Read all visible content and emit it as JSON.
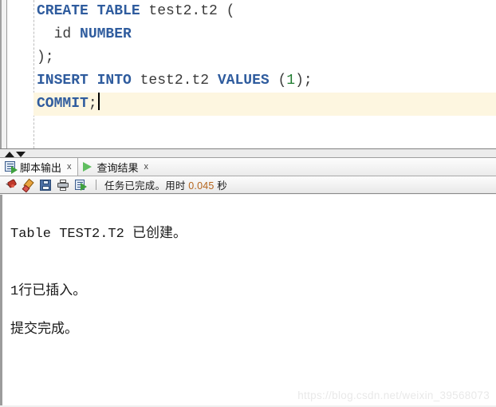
{
  "editor": {
    "lines": [
      {
        "highlighted": false,
        "tokens": [
          {
            "t": "CREATE TABLE",
            "k": "kw"
          },
          {
            "t": " test2.t2 (",
            "k": "id"
          }
        ]
      },
      {
        "highlighted": false,
        "tokens": [
          {
            "t": "  id ",
            "k": "id"
          },
          {
            "t": "NUMBER",
            "k": "kw"
          }
        ]
      },
      {
        "highlighted": false,
        "tokens": [
          {
            "t": ");",
            "k": "id"
          }
        ]
      },
      {
        "highlighted": false,
        "tokens": [
          {
            "t": "INSERT INTO",
            "k": "kw"
          },
          {
            "t": " test2.t2 ",
            "k": "id"
          },
          {
            "t": "VALUES",
            "k": "kw"
          },
          {
            "t": " (",
            "k": "id"
          },
          {
            "t": "1",
            "k": "num"
          },
          {
            "t": ");",
            "k": "id"
          }
        ]
      },
      {
        "highlighted": true,
        "caret": true,
        "tokens": [
          {
            "t": "COMMIT",
            "k": "kw"
          },
          {
            "t": ";",
            "k": "id"
          }
        ]
      }
    ]
  },
  "splitter": {
    "collapse_up_label": "▲",
    "collapse_down_label": "▼"
  },
  "output_panel": {
    "tabs": [
      {
        "label": "脚本输出",
        "close_label": "x",
        "icon": "script-output-icon",
        "active": true
      },
      {
        "label": "查询结果",
        "close_label": "x",
        "icon": "play-green-icon",
        "active": false
      }
    ],
    "toolbar": {
      "buttons": [
        {
          "name": "pin-button",
          "icon": "pin-icon",
          "title": "固定"
        },
        {
          "name": "clear-button",
          "icon": "eraser-icon",
          "title": "清除"
        },
        {
          "name": "save-button",
          "icon": "save-icon",
          "title": "保存"
        },
        {
          "name": "print-button",
          "icon": "print-icon",
          "title": "打印"
        },
        {
          "name": "run-script-button",
          "icon": "run-script-icon",
          "title": "运行脚本"
        }
      ],
      "status_prefix": "任务已完成。用时 ",
      "status_time": "0.045",
      "status_suffix": " 秒",
      "status_full": "任务已完成。用时 0.045 秒"
    },
    "output_lines": [
      "Table TEST2.T2 已创建。",
      "",
      "",
      "1行已插入。",
      "",
      "提交完成。"
    ]
  },
  "watermark": {
    "text": "https://blog.csdn.net/weixin_39568073"
  },
  "colors": {
    "keyword": "#2f5c9e",
    "number": "#1d7a2e",
    "identifier": "#3b3b3b",
    "current_line_highlight": "#fdf6e0",
    "status_time": "#b5651d",
    "panel_background": "#f0f0f0"
  }
}
